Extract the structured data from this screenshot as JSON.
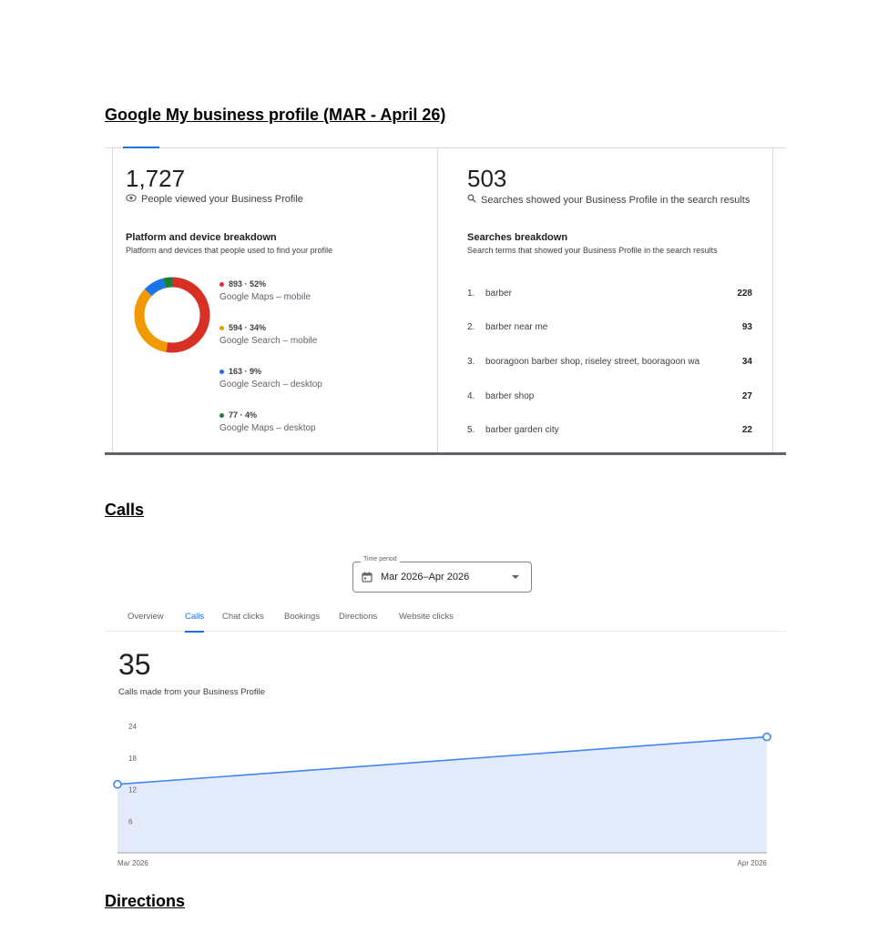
{
  "headings": {
    "gmb": "Google My business profile (MAR - April 26)",
    "calls": "Calls",
    "directions": "Directions"
  },
  "profile": {
    "views": {
      "number": "1,727",
      "label": "People viewed your Business Profile",
      "icon": "eye-icon"
    },
    "platform": {
      "title": "Platform and device breakdown",
      "subtitle": "Platform and devices that people used to find your profile",
      "items": [
        {
          "value": "893 · 52%",
          "label": "Google Maps – mobile",
          "color": "#d93025",
          "share": 52
        },
        {
          "value": "594 · 34%",
          "label": "Google Search – mobile",
          "color": "#f29900",
          "share": 34
        },
        {
          "value": "163 · 9%",
          "label": "Google Search – desktop",
          "color": "#1a73e8",
          "share": 9
        },
        {
          "value": "77 · 4%",
          "label": "Google Maps – desktop",
          "color": "#188038",
          "share": 4
        }
      ]
    },
    "searches": {
      "number": "503",
      "label": "Searches showed your Business Profile in the search results",
      "icon": "search-icon",
      "title": "Searches breakdown",
      "subtitle": "Search terms that showed your Business Profile in the search results",
      "items": [
        {
          "rank": "1.",
          "term": "barber",
          "count": "228"
        },
        {
          "rank": "2.",
          "term": "barber near me",
          "count": "93"
        },
        {
          "rank": "3.",
          "term": "booragoon barber shop, riseley street, booragoon wa",
          "count": "34"
        },
        {
          "rank": "4.",
          "term": "barber shop",
          "count": "27"
        },
        {
          "rank": "5.",
          "term": "barber garden city",
          "count": "22"
        }
      ]
    }
  },
  "calls": {
    "time_period": {
      "legend": "Time period",
      "value": "Mar 2026–Apr 2026",
      "icon": "calendar-icon"
    },
    "tabs": [
      "Overview",
      "Calls",
      "Chat clicks",
      "Bookings",
      "Directions",
      "Website clicks"
    ],
    "active_tab": "Calls",
    "total": "35",
    "caption": "Calls made from your Business Profile",
    "accent": "#4285f4",
    "fill": "#e3ebfb"
  },
  "chart_data": {
    "type": "area",
    "categories": [
      "Mar 2026",
      "Apr 2026"
    ],
    "values": [
      13,
      22
    ],
    "yticks": [
      24,
      18,
      12,
      6
    ],
    "ylim": [
      0,
      24
    ],
    "grid": false,
    "title": "",
    "xlabel": "",
    "ylabel": ""
  }
}
